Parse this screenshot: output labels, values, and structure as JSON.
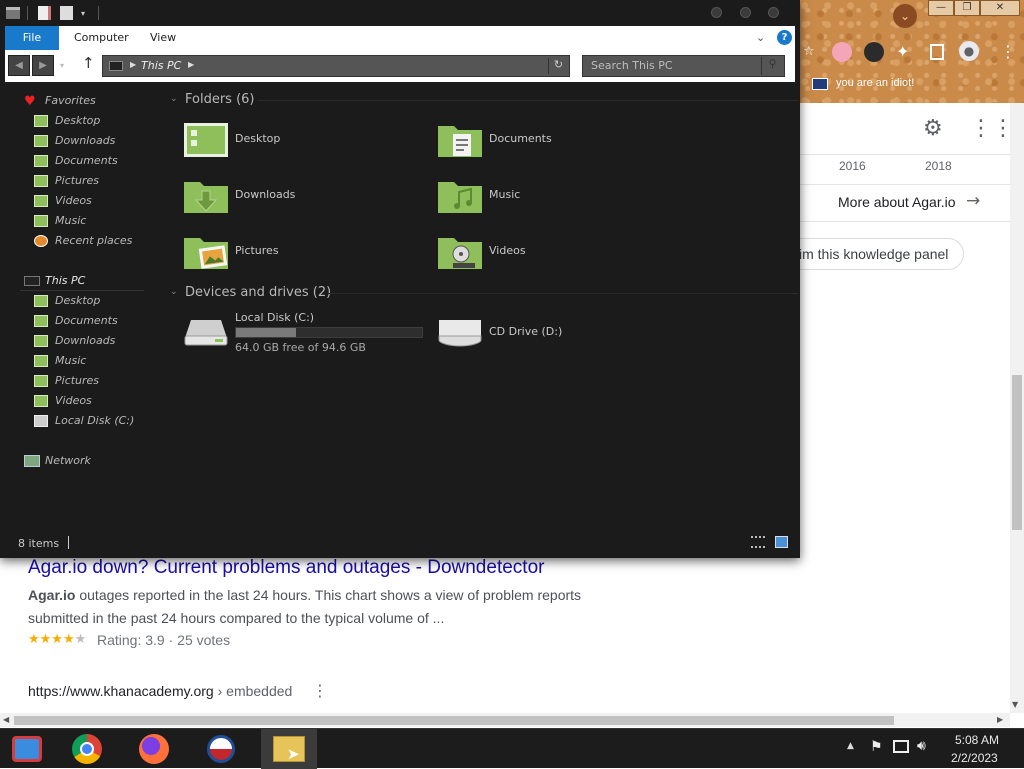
{
  "explorer": {
    "ribbon": {
      "tabs": [
        "File",
        "Computer",
        "View"
      ]
    },
    "address": {
      "location": "This PC"
    },
    "search": {
      "placeholder": "Search This PC"
    },
    "sidebar": {
      "favorites": {
        "label": "Favorites",
        "items": [
          "Desktop",
          "Downloads",
          "Documents",
          "Pictures",
          "Videos",
          "Music",
          "Recent places"
        ]
      },
      "thispc": {
        "label": "This PC",
        "items": [
          "Desktop",
          "Documents",
          "Downloads",
          "Music",
          "Pictures",
          "Videos",
          "Local Disk (C:)"
        ]
      },
      "network": {
        "label": "Network"
      }
    },
    "folders": {
      "header": "Folders (6)",
      "items": [
        "Desktop",
        "Documents",
        "Downloads",
        "Music",
        "Pictures",
        "Videos"
      ]
    },
    "devices": {
      "header": "Devices and drives (2)",
      "local": {
        "name": "Local Disk (C:)",
        "free": "64.0 GB free of 94.6 GB",
        "used_fraction": 0.32
      },
      "cd": {
        "name": "CD Drive (D:)"
      }
    },
    "status": {
      "items": "8 items"
    }
  },
  "browser": {
    "bookmark": "you are an idiot!",
    "years": [
      "2016",
      "2018"
    ],
    "more_about": "More about Agar.io",
    "claim": "im this knowledge panel",
    "result": {
      "title": "Agar.io down? Current problems and outages - Downdetector",
      "snippet_bold": "Agar.io",
      "snippet_line1": " outages reported in the last 24 hours. This chart shows a view of problem reports",
      "snippet_line2": "submitted in the past 24 hours compared to the typical volume of ...",
      "stars": "★★★★★",
      "rating": "Rating: 3.9 · 25 votes"
    },
    "next_url": "https://www.khanacademy.org",
    "next_path": " › embedded"
  },
  "taskbar": {
    "time": "5:08 AM",
    "date": "2/2/2023"
  },
  "colors": {
    "accent": "#1979ca",
    "folder": "#8fbf5a",
    "explorer_bg": "#1b1b1b"
  }
}
